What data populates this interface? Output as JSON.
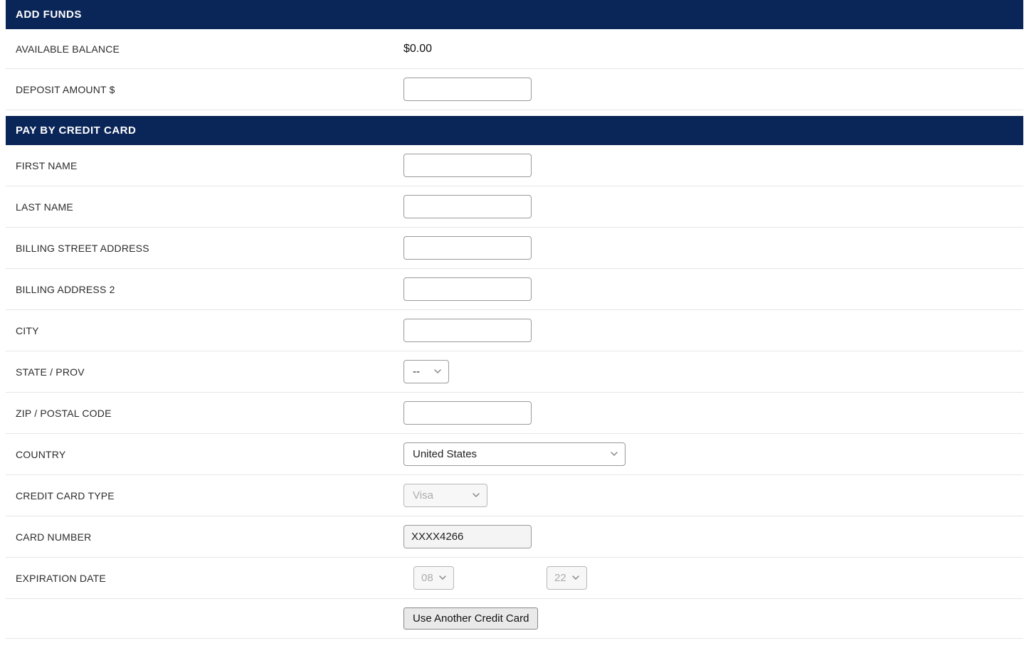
{
  "sections": {
    "add_funds_title": "ADD FUNDS",
    "pay_by_cc_title": "PAY BY CREDIT CARD"
  },
  "balance": {
    "label": "AVAILABLE BALANCE",
    "value": "$0.00"
  },
  "deposit": {
    "label": "DEPOSIT AMOUNT $",
    "value": ""
  },
  "first_name": {
    "label": "FIRST NAME",
    "value": ""
  },
  "last_name": {
    "label": "LAST NAME",
    "value": ""
  },
  "billing_street": {
    "label": "BILLING STREET ADDRESS",
    "value": ""
  },
  "billing2": {
    "label": "BILLING ADDRESS 2",
    "value": ""
  },
  "city": {
    "label": "CITY",
    "value": ""
  },
  "state": {
    "label": "STATE / PROV",
    "selected": "--"
  },
  "zip": {
    "label": "ZIP / POSTAL CODE",
    "value": ""
  },
  "country": {
    "label": "COUNTRY",
    "selected": "United States"
  },
  "cc_type": {
    "label": "CREDIT CARD TYPE",
    "selected": "Visa"
  },
  "card_number": {
    "label": "CARD NUMBER",
    "value": "XXXX4266"
  },
  "expiration": {
    "label": "EXPIRATION DATE",
    "month": "08",
    "year": "22"
  },
  "buttons": {
    "use_another": "Use Another Credit Card"
  }
}
